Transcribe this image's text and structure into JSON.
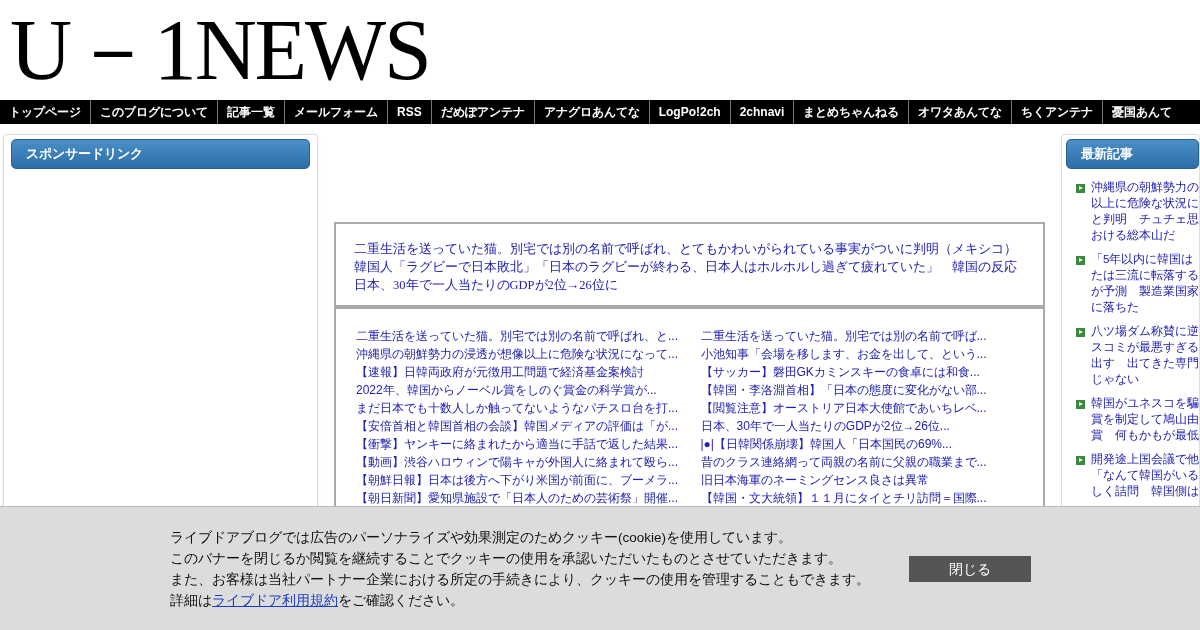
{
  "logo": "U－1NEWS",
  "nav": [
    "トップページ",
    "このブログについて",
    "記事一覧",
    "メールフォーム",
    "RSS",
    "だめぽアンテナ",
    "アナグロあんてな",
    "LogPo!2ch",
    "2chnavi",
    "まとめちゃんねる",
    "オワタあんてな",
    "ちくアンテナ",
    "憂国あんて"
  ],
  "left_sidebar": {
    "title": "スポンサードリンク"
  },
  "featured_links": [
    "二重生活を送っていた猫。別宅では別の名前で呼ばれ、とてもかわいがられている事実がついに判明（メキシコ）",
    "韓国人「ラグビーで日本敗北」「日本のラグビーが終わる、日本人はホルホルし過ぎて疲れていた」　韓国の反応",
    "日本、30年で一人当たりのGDPが2位→26位に"
  ],
  "link_columns": [
    [
      "二重生活を送っていた猫。別宅では別の名前で呼ばれ、と...",
      "沖縄県の朝鮮勢力の浸透が想像以上に危険な状況になって...",
      "【速報】日韓両政府が元徴用工問題で経済基金案検討",
      "2022年、韓国からノーベル賞をしのぐ賞金の科学賞が...",
      "まだ日本でも十数人しか触ってないようなパチスロ台を打...",
      "【安倍首相と韓国首相の会談】韓国メディアの評価は「が...",
      "【衝撃】ヤンキーに絡まれたから適当に手話で返した結果...",
      "【動画】渋谷ハロウィンで陽キャが外国人に絡まれて殴ら...",
      "【朝鮮日報】日本は後方へ下がり米国が前面に、ブーメラ...",
      "【朝日新聞】愛知県施設で「日本人のための芸術祭」開催..."
    ],
    [
      "二重生活を送っていた猫。別宅では別の名前で呼ば...",
      "小池知事「会場を移します、お金を出して、という...",
      "【サッカー】磐田GKカミンスキーの食卓には和食...",
      "【韓国・李洛淵首相】「日本の態度に変化がない部...",
      "【閲覧注意】オーストリア日本大使館であいちレベ...",
      "日本、30年で一人当たりのGDPが2位→26位...",
      "|●|【日韓関係崩壊】韓国人「日本国民の69%...",
      "昔のクラス連絡網って両親の名前に父親の職業まで...",
      "旧日本海軍のネーミングセンス良さは異常",
      "【韓国・文大統領】１１月にタイとチリ訪問＝国際..."
    ]
  ],
  "right_sidebar": {
    "title": "最新記事",
    "items": [
      {
        "lines": [
          "沖縄県の朝鮮勢力の",
          "以上に危険な状況に",
          "と判明　チュチェ思",
          "おける総本山だ"
        ]
      },
      {
        "lines": [
          "「5年以内に韓国は",
          "たは三流に転落する",
          "が予測　製造業国家",
          "に落ちた"
        ]
      },
      {
        "lines": [
          "八ツ場ダム称賛に逆",
          "スコミが最悪すぎる",
          "出す　出てきた専門",
          "じゃない"
        ]
      },
      {
        "lines": [
          "韓国がユネスコを騙",
          "賞を制定して鳩山由",
          "賞　何もかもが最低"
        ]
      },
      {
        "lines": [
          "開発途上国会議で他",
          "「なんて韓国がいる",
          "しく詰問　韓国側は"
        ]
      }
    ]
  },
  "cookie_banner": {
    "lines": [
      "ライブドアブログでは広告のパーソナライズや効果測定のためクッキー(cookie)を使用しています。",
      "このバナーを閉じるか閲覧を継続することでクッキーの使用を承認いただいたものとさせていただきます。",
      "また、お客様は当社パートナー企業における所定の手続きにより、クッキーの使用を管理することもできます。"
    ],
    "detail_prefix": "詳細は",
    "detail_link": "ライブドア利用規約",
    "detail_suffix": "をご確認ください。",
    "close_button": "閉じる"
  }
}
